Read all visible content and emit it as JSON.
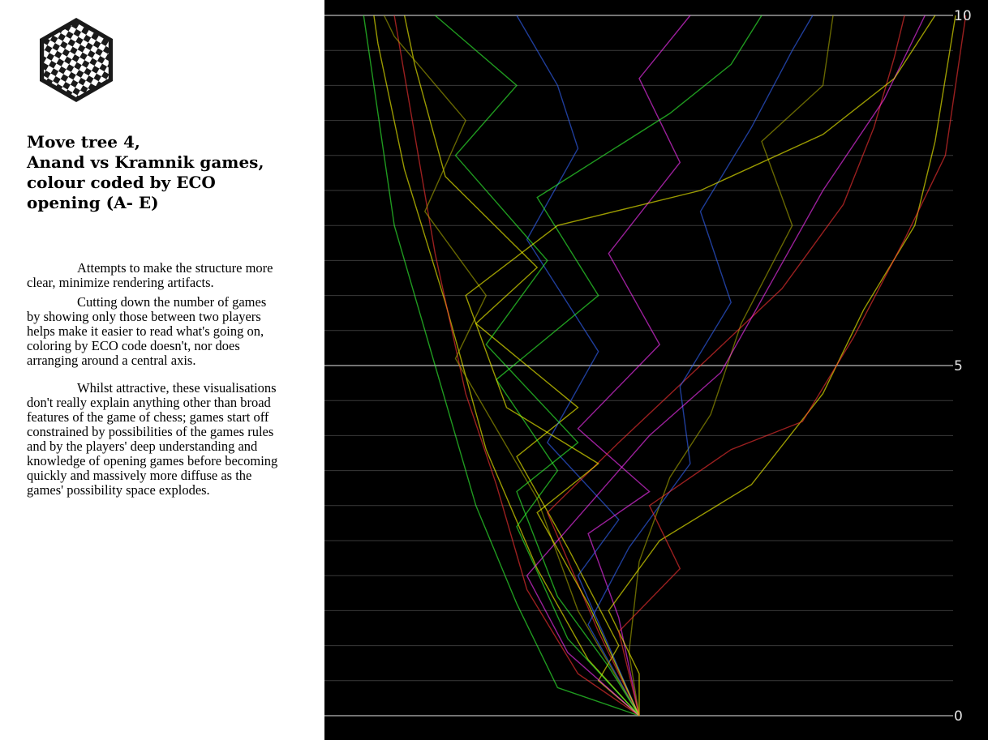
{
  "title_lines": [
    "Move tree 4,",
    "Anand vs Kramnik games,",
    "colour coded by ECO",
    "opening (A- E)"
  ],
  "paragraphs": [
    "Attempts to make the structure more clear, minimize rendering artifacts.",
    "Cutting down the number of games by showing only those between two players helps make it easier to read what's going on, coloring by ECO code doesn't, nor does arranging around a central axis.",
    "Whilst attractive, these visualisations don't really explain anything other than broad features of the game of chess; games start off constrained by possibilities of the games rules and by the players' deep understanding and knowledge of opening games before becoming quickly and massively more diffuse as the games' possibility space explodes."
  ],
  "colors": {
    "background": "#000000",
    "gridline": "#3a3a3a",
    "major_gridline": "#9a9a9a",
    "series_palette": [
      "#ffff00",
      "#33ff33",
      "#ff3333",
      "#3366ff",
      "#ff33ff",
      "#aaaa00"
    ]
  },
  "chart_data": {
    "type": "line",
    "title": "",
    "xlabel": "",
    "ylabel": "",
    "ylim": [
      0,
      10
    ],
    "yticks": [
      0,
      5,
      10
    ],
    "minor_grid_step": 0.5,
    "grid": true,
    "legend": "none",
    "series": [
      {
        "color": "#33ff33",
        "points": [
          [
            0.0,
            0
          ],
          [
            -0.4,
            0.4
          ],
          [
            -0.6,
            1.6
          ],
          [
            -0.8,
            3.0
          ],
          [
            -1.0,
            5.0
          ],
          [
            -1.2,
            7.0
          ],
          [
            -1.3,
            9.0
          ],
          [
            -1.35,
            10.0
          ]
        ]
      },
      {
        "color": "#ffff00",
        "points": [
          [
            0.0,
            0
          ],
          [
            -0.25,
            0.8
          ],
          [
            -0.5,
            2.1
          ],
          [
            -0.75,
            3.8
          ],
          [
            -0.95,
            5.9
          ],
          [
            -1.15,
            7.8
          ],
          [
            -1.28,
            9.6
          ],
          [
            -1.3,
            10.0
          ]
        ]
      },
      {
        "color": "#ff3333",
        "points": [
          [
            0.0,
            0
          ],
          [
            -0.3,
            0.6
          ],
          [
            -0.55,
            1.8
          ],
          [
            -0.7,
            3.3
          ],
          [
            -0.85,
            4.6
          ],
          [
            -1.0,
            6.6
          ],
          [
            -1.1,
            8.3
          ],
          [
            -1.2,
            10.0
          ]
        ]
      },
      {
        "color": "#ffff00",
        "points": [
          [
            0.0,
            0
          ],
          [
            -0.2,
            0.5
          ],
          [
            -0.1,
            1.0
          ],
          [
            -0.35,
            2.4
          ],
          [
            -0.6,
            3.7
          ],
          [
            -0.3,
            4.4
          ],
          [
            -0.8,
            5.6
          ],
          [
            -0.5,
            6.4
          ],
          [
            -0.95,
            7.7
          ],
          [
            -1.1,
            9.3
          ],
          [
            -1.15,
            10.0
          ]
        ]
      },
      {
        "color": "#3366ff",
        "points": [
          [
            0.0,
            0
          ],
          [
            -0.15,
            1.0
          ],
          [
            -0.3,
            2.0
          ],
          [
            -0.1,
            2.8
          ],
          [
            -0.45,
            3.9
          ],
          [
            -0.2,
            5.2
          ],
          [
            -0.55,
            6.8
          ],
          [
            -0.3,
            8.1
          ],
          [
            -0.4,
            9.0
          ],
          [
            -0.6,
            10.0
          ]
        ]
      },
      {
        "color": "#ff33ff",
        "points": [
          [
            0.0,
            0
          ],
          [
            -0.1,
            1.4
          ],
          [
            -0.25,
            2.6
          ],
          [
            0.05,
            3.2
          ],
          [
            -0.3,
            4.1
          ],
          [
            0.1,
            5.3
          ],
          [
            -0.15,
            6.6
          ],
          [
            0.2,
            7.9
          ],
          [
            0.0,
            9.1
          ],
          [
            0.25,
            10.0
          ]
        ]
      },
      {
        "color": "#aaaa00",
        "points": [
          [
            0.0,
            0
          ],
          [
            -0.05,
            0.9
          ],
          [
            0.0,
            2.2
          ],
          [
            0.15,
            3.4
          ],
          [
            0.35,
            4.3
          ],
          [
            0.5,
            5.6
          ],
          [
            0.75,
            7.0
          ],
          [
            0.6,
            8.2
          ],
          [
            0.9,
            9.0
          ],
          [
            0.95,
            10.0
          ]
        ]
      },
      {
        "color": "#33ff33",
        "points": [
          [
            0.0,
            0
          ],
          [
            -0.35,
            1.1
          ],
          [
            -0.6,
            2.7
          ],
          [
            -0.4,
            3.5
          ],
          [
            -0.7,
            4.8
          ],
          [
            -0.2,
            6.0
          ],
          [
            -0.5,
            7.4
          ],
          [
            0.15,
            8.6
          ],
          [
            0.45,
            9.3
          ],
          [
            0.6,
            10.0
          ]
        ]
      },
      {
        "color": "#ff3333",
        "points": [
          [
            0.0,
            0
          ],
          [
            -0.2,
            1.2
          ],
          [
            -0.45,
            2.9
          ],
          [
            -0.1,
            3.9
          ],
          [
            0.3,
            5.0
          ],
          [
            0.7,
            6.1
          ],
          [
            1.0,
            7.3
          ],
          [
            1.15,
            8.4
          ],
          [
            1.25,
            9.4
          ],
          [
            1.3,
            10.0
          ]
        ]
      },
      {
        "color": "#ffff00",
        "points": [
          [
            0.0,
            0
          ],
          [
            0.0,
            0.6
          ],
          [
            -0.15,
            1.5
          ],
          [
            0.1,
            2.5
          ],
          [
            0.55,
            3.3
          ],
          [
            0.9,
            4.6
          ],
          [
            1.1,
            5.8
          ],
          [
            1.35,
            7.0
          ],
          [
            1.45,
            8.2
          ],
          [
            1.55,
            10.0
          ]
        ]
      },
      {
        "color": "#3366ff",
        "points": [
          [
            0.0,
            0
          ],
          [
            -0.25,
            1.3
          ],
          [
            -0.05,
            2.4
          ],
          [
            0.25,
            3.6
          ],
          [
            0.2,
            4.7
          ],
          [
            0.45,
            5.9
          ],
          [
            0.3,
            7.2
          ],
          [
            0.55,
            8.4
          ],
          [
            0.75,
            9.5
          ],
          [
            0.85,
            10.0
          ]
        ]
      },
      {
        "color": "#ff33ff",
        "points": [
          [
            0.0,
            0
          ],
          [
            -0.35,
            0.9
          ],
          [
            -0.55,
            2.0
          ],
          [
            -0.25,
            3.0
          ],
          [
            0.05,
            4.0
          ],
          [
            0.4,
            4.9
          ],
          [
            0.65,
            6.2
          ],
          [
            0.9,
            7.5
          ],
          [
            1.2,
            8.8
          ],
          [
            1.4,
            10.0
          ]
        ]
      },
      {
        "color": "#aaaa00",
        "points": [
          [
            0.0,
            0
          ],
          [
            -0.3,
            1.5
          ],
          [
            -0.5,
            3.1
          ],
          [
            -0.9,
            5.1
          ],
          [
            -0.75,
            6.0
          ],
          [
            -1.05,
            7.2
          ],
          [
            -0.85,
            8.5
          ],
          [
            -1.2,
            9.7
          ],
          [
            -1.25,
            10.0
          ]
        ]
      },
      {
        "color": "#33ff33",
        "points": [
          [
            0.0,
            0
          ],
          [
            -0.15,
            0.7
          ],
          [
            -0.4,
            1.7
          ],
          [
            -0.6,
            3.2
          ],
          [
            -0.3,
            3.9
          ],
          [
            -0.75,
            5.3
          ],
          [
            -0.45,
            6.5
          ],
          [
            -0.9,
            8.0
          ],
          [
            -0.6,
            9.0
          ],
          [
            -1.0,
            10.0
          ]
        ]
      },
      {
        "color": "#ffff00",
        "points": [
          [
            0.0,
            0
          ],
          [
            -0.25,
            1.6
          ],
          [
            -0.5,
            2.9
          ],
          [
            -0.2,
            3.6
          ],
          [
            -0.65,
            4.4
          ],
          [
            -0.85,
            6.0
          ],
          [
            -0.4,
            7.0
          ],
          [
            0.3,
            7.5
          ],
          [
            0.9,
            8.3
          ],
          [
            1.25,
            9.1
          ],
          [
            1.45,
            10.0
          ]
        ]
      },
      {
        "color": "#ff3333",
        "points": [
          [
            0.0,
            0
          ],
          [
            -0.1,
            1.2
          ],
          [
            0.2,
            2.1
          ],
          [
            0.05,
            3.0
          ],
          [
            0.45,
            3.8
          ],
          [
            0.8,
            4.2
          ],
          [
            1.05,
            5.4
          ],
          [
            1.3,
            6.8
          ],
          [
            1.5,
            8.0
          ],
          [
            1.6,
            10.0
          ]
        ]
      }
    ]
  }
}
